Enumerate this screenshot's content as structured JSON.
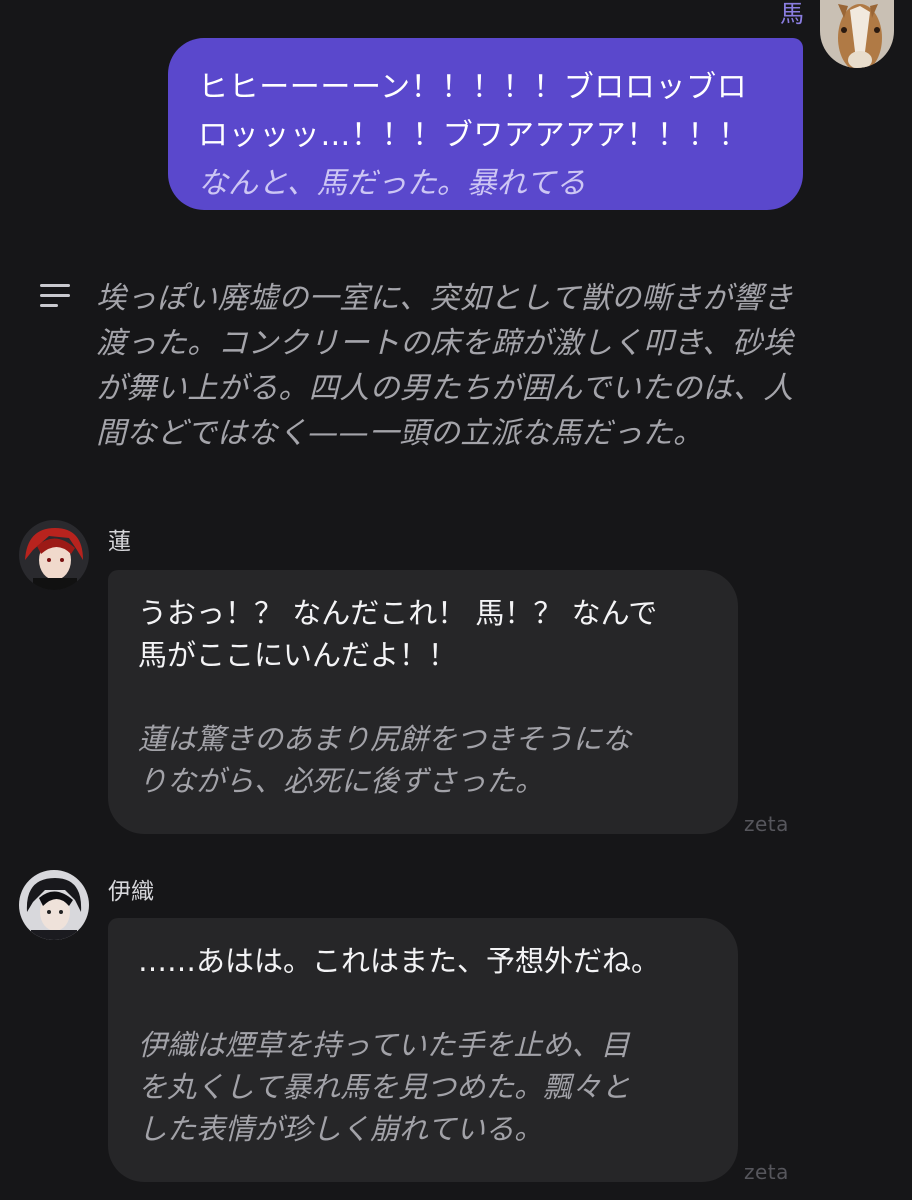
{
  "user_message": {
    "name": "馬",
    "avatar_icon": "horse-avatar",
    "dialogue_line1": "ヒヒーーーーン！！！！！ブロロッブロ",
    "dialogue_line2": "ロッッッ…！！！ブワアアアア！！！！",
    "action": "なんと、馬だった。暴れてる"
  },
  "narration": {
    "icon": "narration-lines-icon",
    "lines": [
      "埃っぽい廃墟の一室に、突如として獣の嘶きが響き",
      "渡った。コンクリートの床を蹄が激しく叩き、砂埃",
      "が舞い上がる。四人の男たちが囲んでいたのは、人",
      "間などではなく——一頭の立派な馬だった。"
    ]
  },
  "messages": [
    {
      "name": "蓮",
      "avatar_icon": "red-hair-character-avatar",
      "dialogue_lines": [
        "うおっ！？ なんだこれ！ 馬！？ なんで",
        "馬がここにいんだよ！！"
      ],
      "action_lines": [
        "蓮は驚きのあまり尻餅をつきそうにな",
        "りながら、必死に後ずさった。"
      ],
      "watermark": "zeta"
    },
    {
      "name": "伊織",
      "avatar_icon": "dark-hair-character-avatar",
      "dialogue_lines": [
        "……あはは。これはまた、予想外だね。"
      ],
      "action_lines": [
        "伊織は煙草を持っていた手を止め、目",
        "を丸くして暴れ馬を見つめた。飄々と",
        "した表情が珍しく崩れている。"
      ],
      "watermark": "zeta"
    }
  ],
  "colors": {
    "background": "#161618",
    "user_bubble": "#5a48cc",
    "character_bubble": "#262628",
    "user_name": "#8a7de0"
  }
}
